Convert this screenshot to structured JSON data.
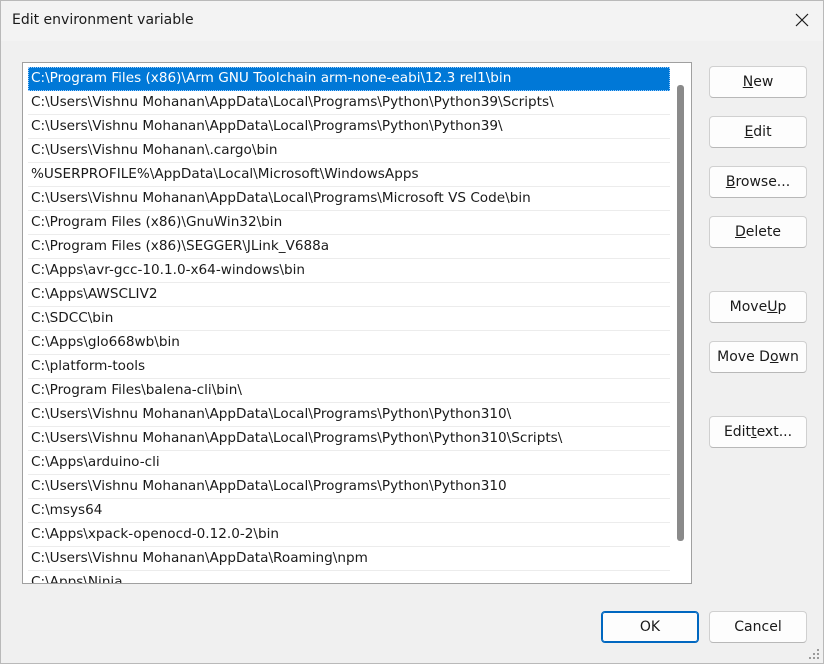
{
  "window": {
    "title": "Edit environment variable"
  },
  "list": {
    "items": [
      "C:\\Program Files (x86)\\Arm GNU Toolchain arm-none-eabi\\12.3 rel1\\bin",
      "C:\\Users\\Vishnu Mohanan\\AppData\\Local\\Programs\\Python\\Python39\\Scripts\\",
      "C:\\Users\\Vishnu Mohanan\\AppData\\Local\\Programs\\Python\\Python39\\",
      "C:\\Users\\Vishnu Mohanan\\.cargo\\bin",
      "%USERPROFILE%\\AppData\\Local\\Microsoft\\WindowsApps",
      "C:\\Users\\Vishnu Mohanan\\AppData\\Local\\Programs\\Microsoft VS Code\\bin",
      "C:\\Program Files (x86)\\GnuWin32\\bin",
      "C:\\Program Files (x86)\\SEGGER\\JLink_V688a",
      "C:\\Apps\\avr-gcc-10.1.0-x64-windows\\bin",
      "C:\\Apps\\AWSCLIV2",
      "C:\\SDCC\\bin",
      "C:\\Apps\\glo668wb\\bin",
      "C:\\platform-tools",
      "C:\\Program Files\\balena-cli\\bin\\",
      "C:\\Users\\Vishnu Mohanan\\AppData\\Local\\Programs\\Python\\Python310\\",
      "C:\\Users\\Vishnu Mohanan\\AppData\\Local\\Programs\\Python\\Python310\\Scripts\\",
      "C:\\Apps\\arduino-cli",
      "C:\\Users\\Vishnu Mohanan\\AppData\\Local\\Programs\\Python\\Python310",
      "C:\\msys64",
      "C:\\Apps\\xpack-openocd-0.12.0-2\\bin",
      "C:\\Users\\Vishnu Mohanan\\AppData\\Roaming\\npm",
      "C:\\Apps\\Ninja"
    ],
    "selected_index": 0
  },
  "buttons": {
    "new": {
      "pre": "",
      "key": "N",
      "post": "ew"
    },
    "edit": {
      "pre": "",
      "key": "E",
      "post": "dit"
    },
    "browse": {
      "pre": "",
      "key": "B",
      "post": "rowse..."
    },
    "delete": {
      "pre": "",
      "key": "D",
      "post": "elete"
    },
    "move_up": {
      "pre": "Move ",
      "key": "U",
      "post": "p"
    },
    "move_down": {
      "pre": "Move D",
      "key": "o",
      "post": "wn"
    },
    "edit_text": {
      "pre": "Edit ",
      "key": "t",
      "post": "ext..."
    },
    "ok": "OK",
    "cancel": "Cancel"
  },
  "colors": {
    "selection": "#0078d7",
    "primary_border": "#0067c0"
  }
}
